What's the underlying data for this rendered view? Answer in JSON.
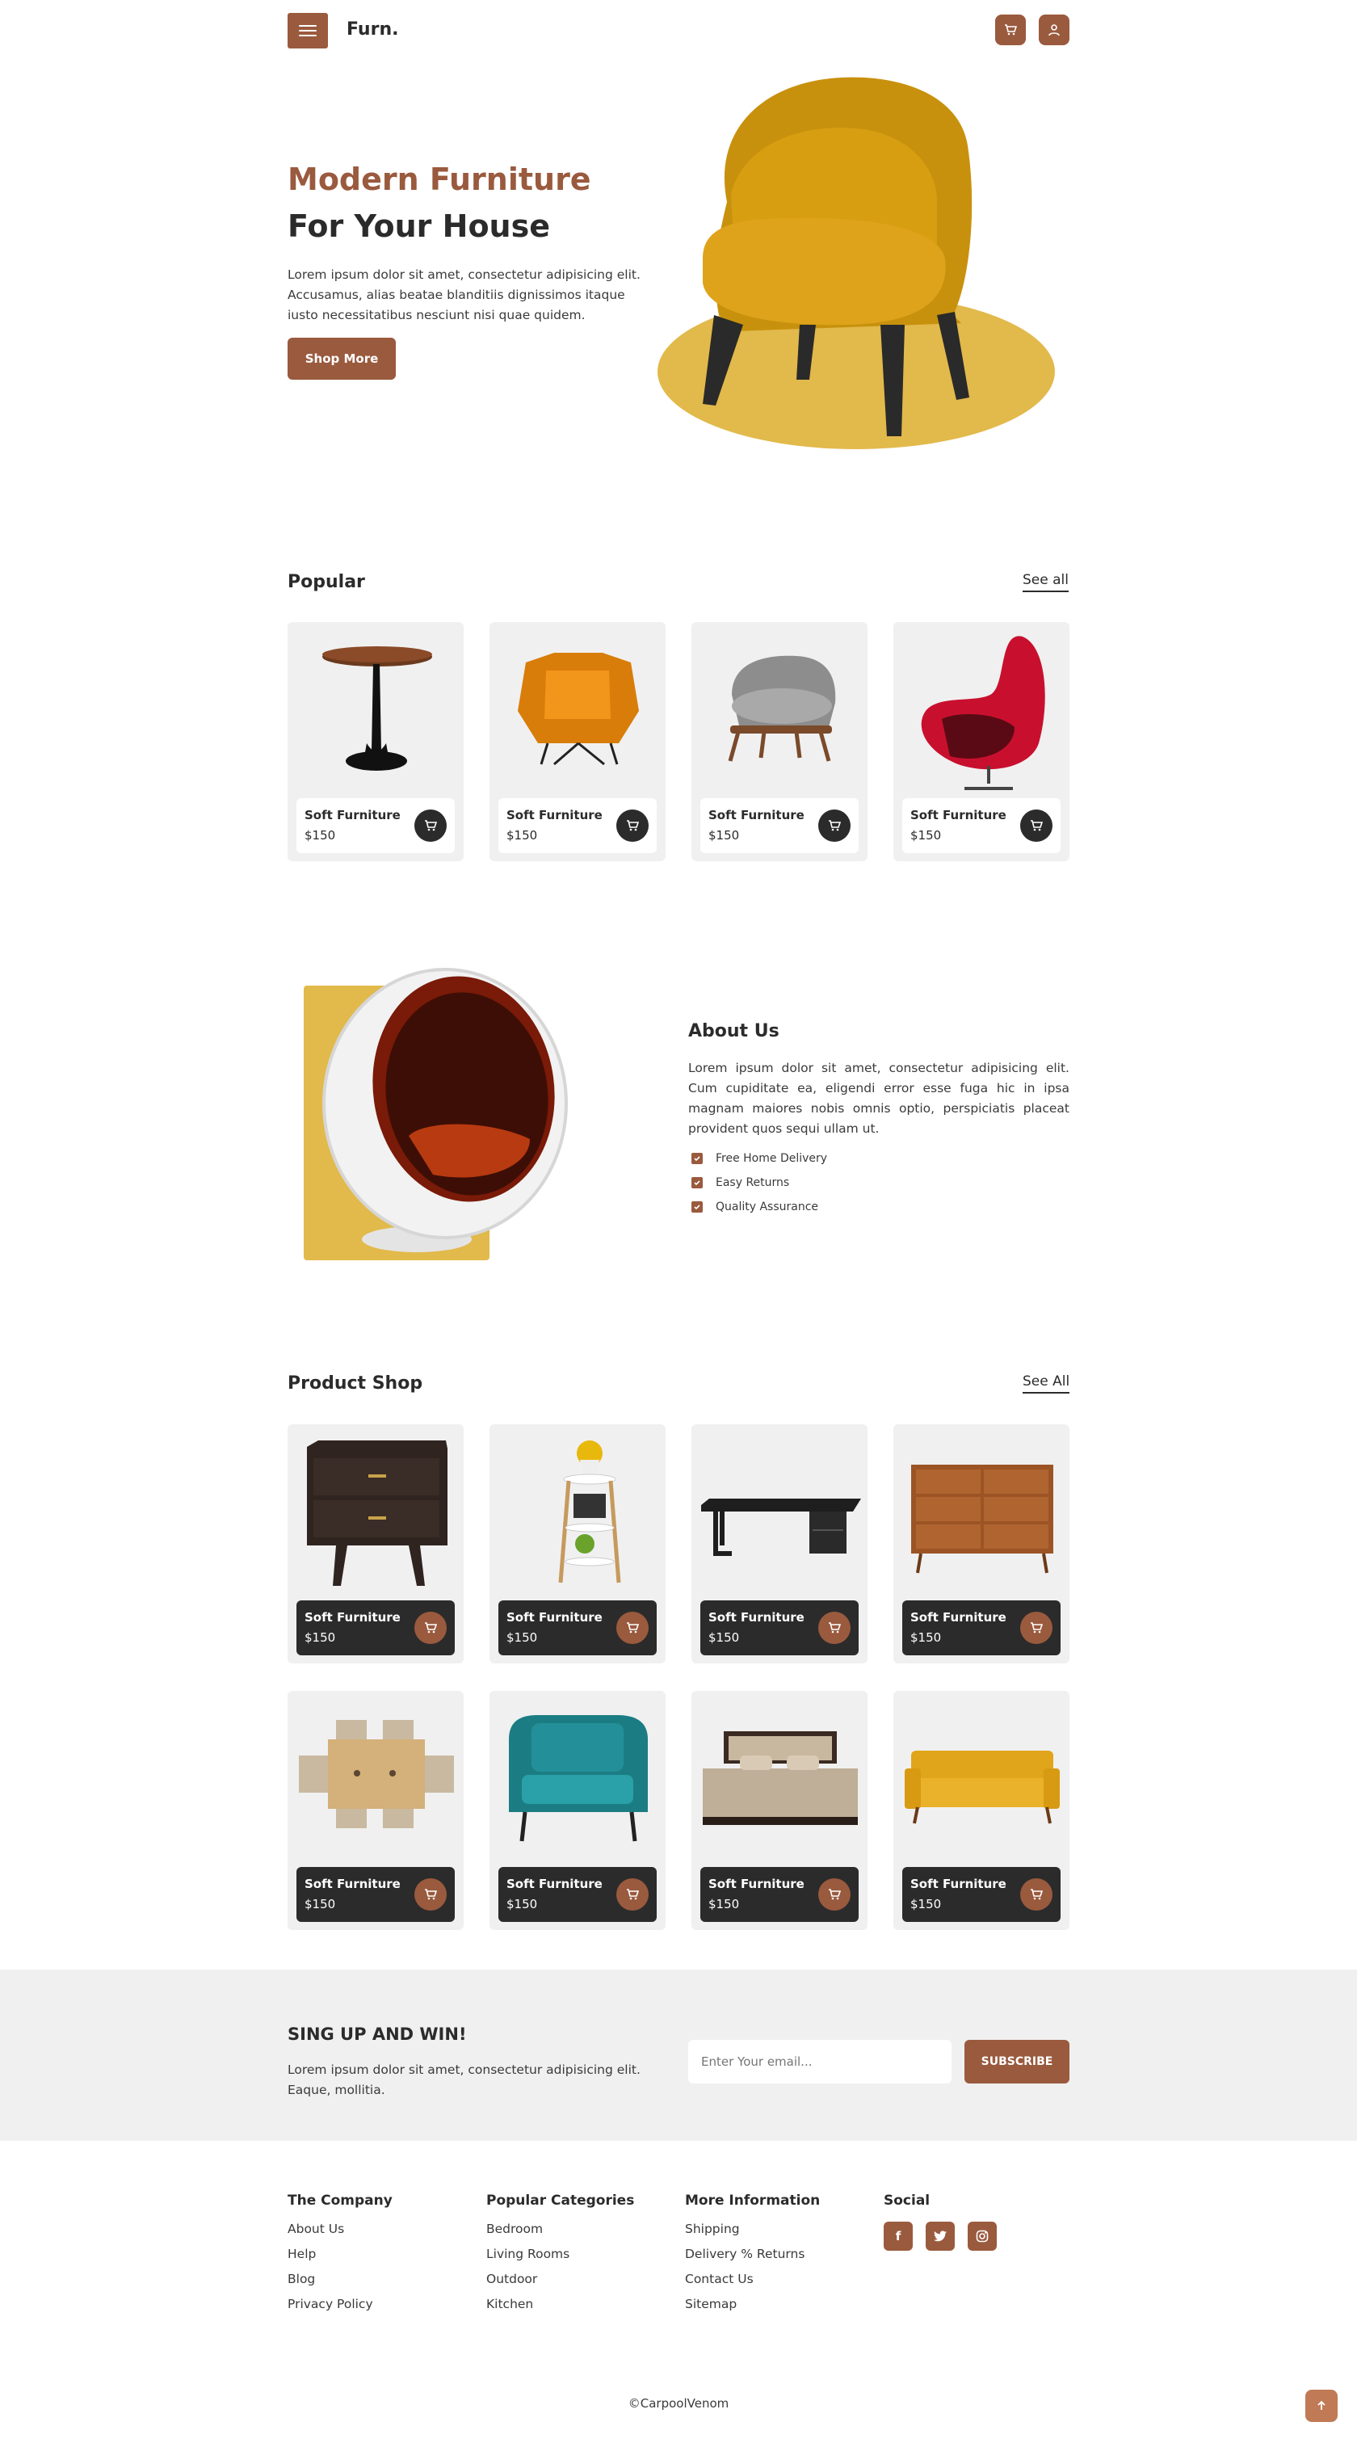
{
  "header": {
    "logo": "Furn."
  },
  "hero": {
    "title_line1": "Modern Furniture",
    "title_line2": "For Your House",
    "description": "Lorem ipsum dolor sit amet, consectetur adipisicing elit. Accusamus, alias beatae blanditiis dignissimos itaque iusto necessitatibus nesciunt nisi quae quidem.",
    "button": "Shop More"
  },
  "popular": {
    "title": "Popular",
    "see_all": "See all",
    "items": [
      {
        "name": "Soft Furniture",
        "price": "$150",
        "icon": "side-table"
      },
      {
        "name": "Soft Furniture",
        "price": "$150",
        "icon": "orange-armchair"
      },
      {
        "name": "Soft Furniture",
        "price": "$150",
        "icon": "grey-lounge-chair"
      },
      {
        "name": "Soft Furniture",
        "price": "$150",
        "icon": "red-egg-chair"
      }
    ]
  },
  "about": {
    "title": "About Us",
    "description": "Lorem ipsum dolor sit amet, consectetur adipisicing elit. Cum cupiditate ea, eligendi error esse fuga hic in ipsa magnam maiores nobis omnis optio, perspiciatis placeat provident quos sequi ullam ut.",
    "features": [
      "Free Home Delivery",
      "Easy Returns",
      "Quality Assurance"
    ]
  },
  "shop": {
    "title": "Product Shop",
    "see_all": "See All",
    "items": [
      {
        "name": "Soft Furniture",
        "price": "$150",
        "icon": "nightstand"
      },
      {
        "name": "Soft Furniture",
        "price": "$150",
        "icon": "plant-stand"
      },
      {
        "name": "Soft Furniture",
        "price": "$150",
        "icon": "desk"
      },
      {
        "name": "Soft Furniture",
        "price": "$150",
        "icon": "dresser"
      },
      {
        "name": "Soft Furniture",
        "price": "$150",
        "icon": "dining-set"
      },
      {
        "name": "Soft Furniture",
        "price": "$150",
        "icon": "teal-armchair"
      },
      {
        "name": "Soft Furniture",
        "price": "$150",
        "icon": "bed"
      },
      {
        "name": "Soft Furniture",
        "price": "$150",
        "icon": "yellow-sofa"
      }
    ]
  },
  "signup": {
    "title": "SING UP AND WIN!",
    "description": "Lorem ipsum dolor sit amet, consectetur adipisicing elit. Eaque, mollitia.",
    "placeholder": "Enter Your email...",
    "button": "SUBSCRIBE"
  },
  "footer": {
    "company": {
      "title": "The Company",
      "links": [
        "About Us",
        "Help",
        "Blog",
        "Privacy Policy"
      ]
    },
    "categories": {
      "title": "Popular Categories",
      "links": [
        "Bedroom",
        "Living Rooms",
        "Outdoor",
        "Kitchen"
      ]
    },
    "info": {
      "title": "More Information",
      "links": [
        "Shipping",
        "Delivery % Returns",
        "Contact Us",
        "Sitemap"
      ]
    },
    "social": {
      "title": "Social",
      "icons": [
        "facebook-icon",
        "twitter-icon",
        "instagram-icon"
      ]
    },
    "copyright": "©CarpoolVenom"
  },
  "colors": {
    "accent": "#9a5a3e",
    "dark": "#2b2b2b",
    "yellow": "#e2b94b",
    "panel": "#f0f0f0"
  }
}
